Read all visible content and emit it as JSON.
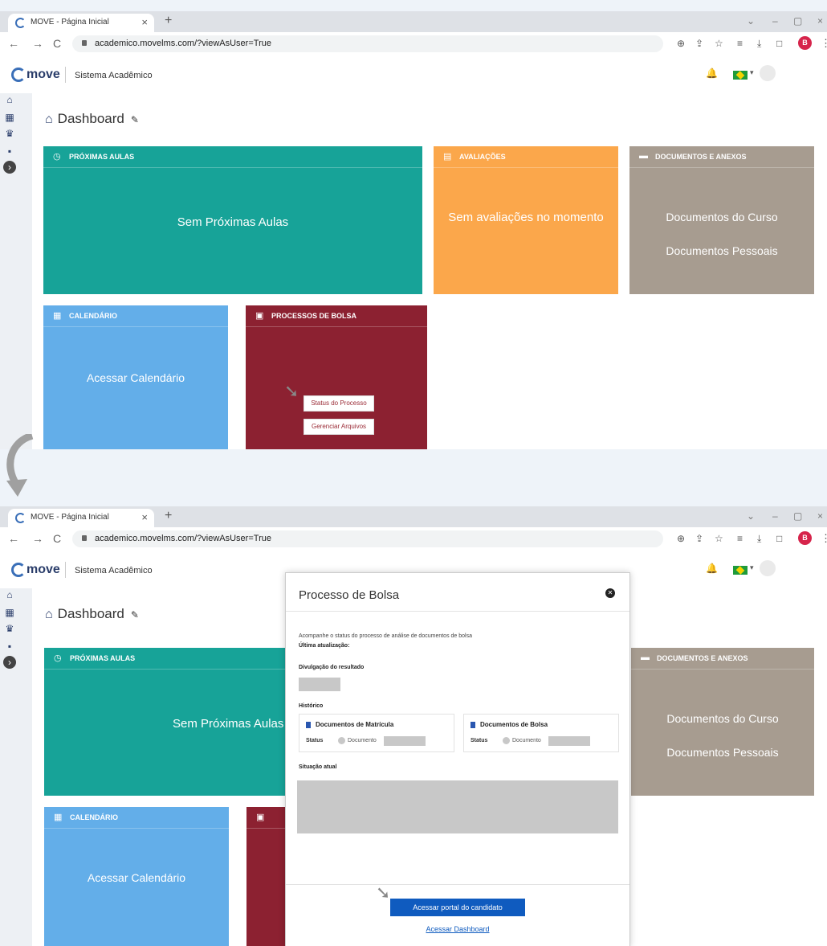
{
  "browser": {
    "tab_title": "MOVE - Página Inicial",
    "tab_close": "×",
    "new_tab": "+",
    "url": "academico.movelms.com/?viewAsUser=True",
    "profile_initial": "B"
  },
  "app": {
    "logo_text": "move",
    "system_name": "Sistema Acadêmico"
  },
  "dashboard": {
    "title": "Dashboard"
  },
  "cards": {
    "proximas_aulas": {
      "title": "PRÓXIMAS AULAS",
      "body": "Sem Próximas Aulas",
      "color": "#17a398"
    },
    "avaliacoes": {
      "title": "AVALIAÇÕES",
      "body": "Sem avaliações no momento",
      "color": "#fba74b"
    },
    "documentos": {
      "title": "DOCUMENTOS E ANEXOS",
      "link1": "Documentos do Curso",
      "link2": "Documentos Pessoais",
      "color": "#a79c90"
    },
    "calendario": {
      "title": "CALENDÁRIO",
      "body": "Acessar Calendário",
      "color": "#63aee9"
    },
    "bolsa": {
      "title": "PROCESSOS DE BOLSA",
      "btn_status": "Status do Processo",
      "btn_arquivos": "Gerenciar Arquivos",
      "color": "#8c2131"
    }
  },
  "modal": {
    "title": "Processo de Bolsa",
    "intro": "Acompanhe o status do processo de análise de documentos de bolsa",
    "last_update_label": "Última atualização:",
    "result_label": "Divulgação do resultado",
    "history_label": "Histórico",
    "doc_matricula": "Documentos de Matrícula",
    "doc_bolsa": "Documentos de Bolsa",
    "status_label": "Status",
    "document_label": "Documento",
    "current_label": "Situação atual",
    "primary_button": "Acessar portal do candidato",
    "link": "Acessar Dashboard"
  }
}
